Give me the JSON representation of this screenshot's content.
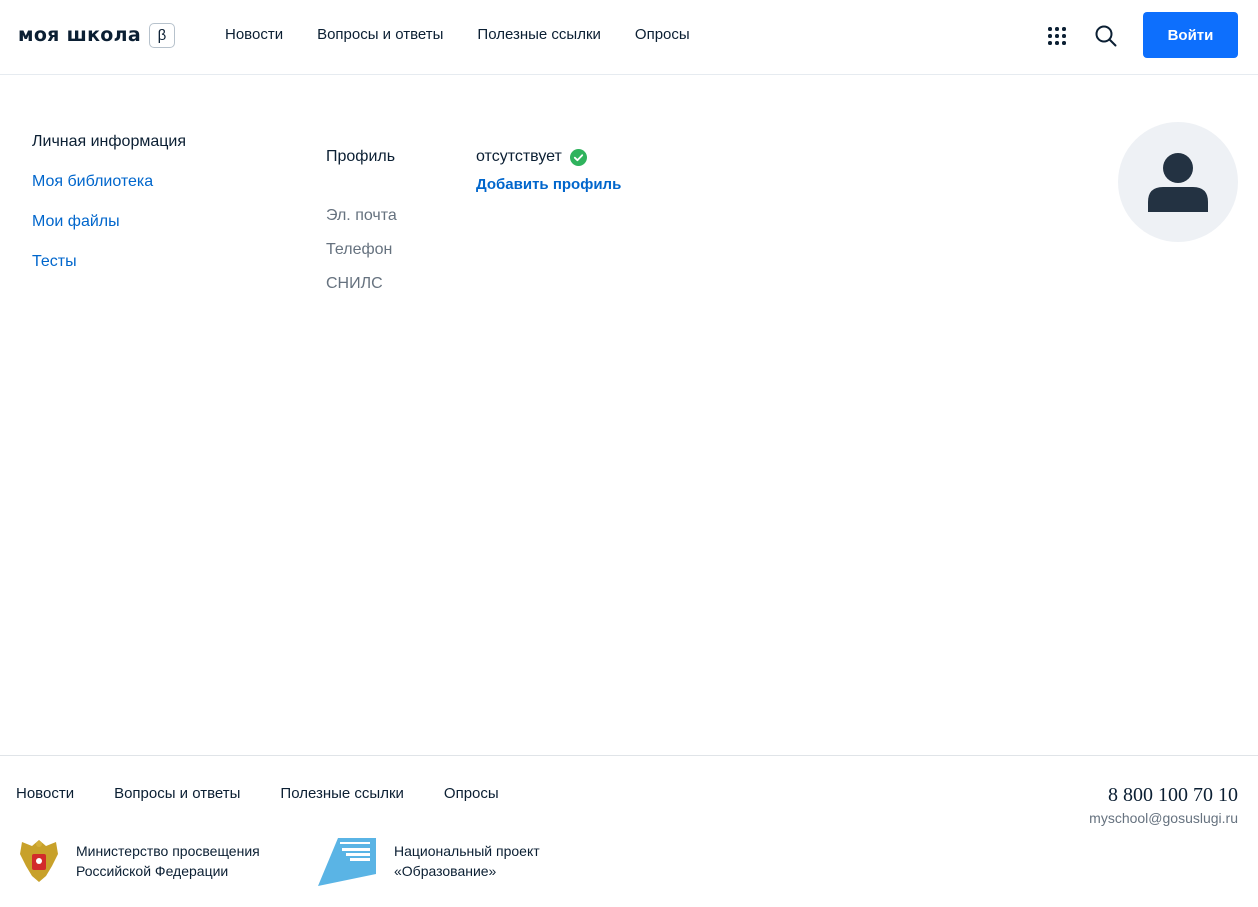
{
  "header": {
    "logo": "моя школа",
    "beta": "β",
    "nav": [
      "Новости",
      "Вопросы и ответы",
      "Полезные ссылки",
      "Опросы"
    ],
    "login_label": "Войти",
    "icons": [
      "apps-grid-icon",
      "search-icon"
    ],
    "accent_color": "#0d6ffd"
  },
  "sidebar": {
    "items": [
      {
        "label": "Личная информация",
        "active": true
      },
      {
        "label": "Моя библиотека"
      },
      {
        "label": "Мои файлы"
      },
      {
        "label": "Тесты"
      }
    ]
  },
  "profile": {
    "profile_label": "Профиль",
    "profile_value": "отсутствует",
    "add_profile_link": "Добавить профиль",
    "email_label": "Эл. почта",
    "phone_label": "Телефон",
    "snils_label": "СНИЛС"
  },
  "footer": {
    "nav": [
      "Новости",
      "Вопросы и ответы",
      "Полезные ссылки",
      "Опросы"
    ],
    "phone": "8 800 100 70 10",
    "email": "myschool@gosuslugi.ru",
    "ministry": {
      "line1": "Министерство просвещения",
      "line2": "Российской Федерации"
    },
    "project": {
      "line1": "Национальный проект",
      "line2": "«Образование»"
    }
  }
}
